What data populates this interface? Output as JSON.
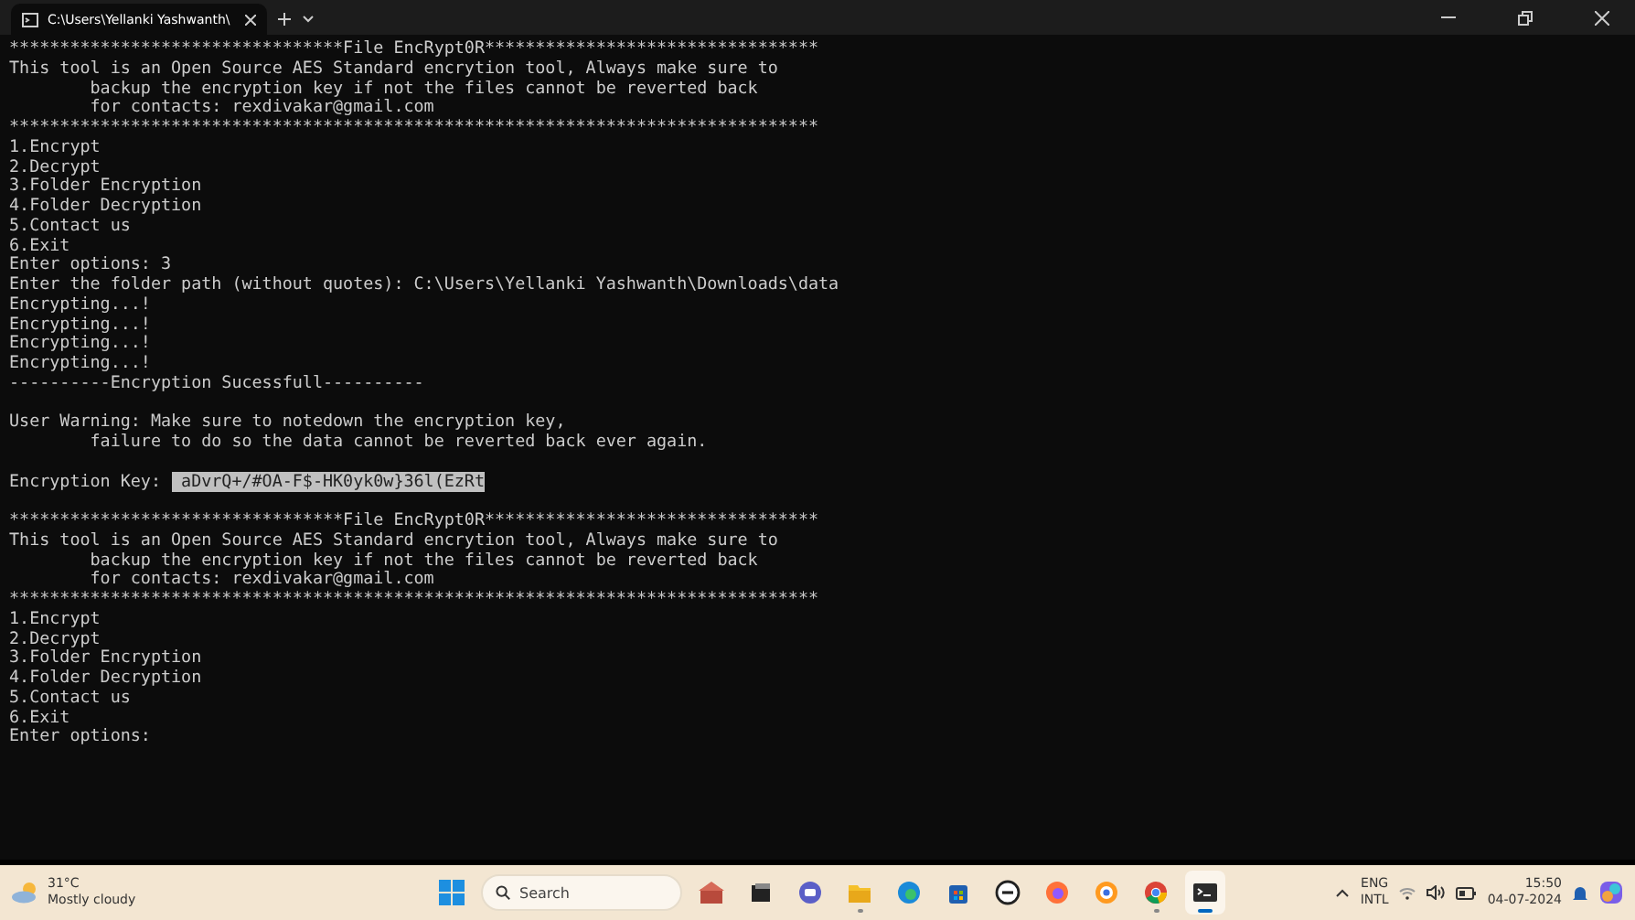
{
  "window": {
    "tab_title": "C:\\Users\\Yellanki Yashwanth\\",
    "tab_selected": true
  },
  "terminal": {
    "lines": [
      {
        "kind": "text",
        "text": "*********************************File EncRypt0R*********************************"
      },
      {
        "kind": "text",
        "text": "This tool is an Open Source AES Standard encrytion tool, Always make sure to"
      },
      {
        "kind": "text",
        "text": "        backup the encryption key if not the files cannot be reverted back"
      },
      {
        "kind": "text",
        "text": "        for contacts: rexdivakar@gmail.com"
      },
      {
        "kind": "text",
        "text": "********************************************************************************"
      },
      {
        "kind": "text",
        "text": "1.Encrypt"
      },
      {
        "kind": "text",
        "text": "2.Decrypt"
      },
      {
        "kind": "text",
        "text": "3.Folder Encryption"
      },
      {
        "kind": "text",
        "text": "4.Folder Decryption"
      },
      {
        "kind": "text",
        "text": "5.Contact us"
      },
      {
        "kind": "text",
        "text": "6.Exit"
      },
      {
        "kind": "text",
        "text": "Enter options: 3"
      },
      {
        "kind": "text",
        "text": "Enter the folder path (without quotes): C:\\Users\\Yellanki Yashwanth\\Downloads\\data"
      },
      {
        "kind": "text",
        "text": "Encrypting...!"
      },
      {
        "kind": "text",
        "text": "Encrypting...!"
      },
      {
        "kind": "text",
        "text": "Encrypting...!"
      },
      {
        "kind": "text",
        "text": "Encrypting...!"
      },
      {
        "kind": "text",
        "text": "----------Encryption Sucessfull----------"
      },
      {
        "kind": "blank"
      },
      {
        "kind": "text",
        "text": "User Warning: Make sure to notedown the encryption key,"
      },
      {
        "kind": "text",
        "text": "        failure to do so the data cannot be reverted back ever again."
      },
      {
        "kind": "blank"
      },
      {
        "kind": "selection",
        "text": "Encryption Key: ",
        "selected_text": " aDvrQ+/#OA-F$-HK0yk0w}36l(EzRt"
      },
      {
        "kind": "blank"
      },
      {
        "kind": "text",
        "text": "*********************************File EncRypt0R*********************************"
      },
      {
        "kind": "text",
        "text": "This tool is an Open Source AES Standard encrytion tool, Always make sure to"
      },
      {
        "kind": "text",
        "text": "        backup the encryption key if not the files cannot be reverted back"
      },
      {
        "kind": "text",
        "text": "        for contacts: rexdivakar@gmail.com"
      },
      {
        "kind": "text",
        "text": "********************************************************************************"
      },
      {
        "kind": "text",
        "text": "1.Encrypt"
      },
      {
        "kind": "text",
        "text": "2.Decrypt"
      },
      {
        "kind": "text",
        "text": "3.Folder Encryption"
      },
      {
        "kind": "text",
        "text": "4.Folder Decryption"
      },
      {
        "kind": "text",
        "text": "5.Contact us"
      },
      {
        "kind": "text",
        "text": "6.Exit"
      },
      {
        "kind": "text",
        "text": "Enter options:"
      }
    ]
  },
  "taskbar": {
    "weather": {
      "temperature": "31°C",
      "condition": "Mostly cloudy"
    },
    "search": {
      "placeholder": "Search"
    },
    "apps": [
      {
        "kind": "start",
        "running": false,
        "selected": false
      },
      {
        "kind": "search"
      },
      {
        "kind": "landmark",
        "running": false,
        "selected": false
      },
      {
        "kind": "taskview",
        "running": false,
        "selected": false
      },
      {
        "kind": "chat",
        "running": false,
        "selected": false
      },
      {
        "kind": "folder",
        "running": true,
        "selected": false
      },
      {
        "kind": "edge",
        "running": false,
        "selected": false
      },
      {
        "kind": "store",
        "running": false,
        "selected": false
      },
      {
        "kind": "dell",
        "running": false,
        "selected": false
      },
      {
        "kind": "firefox",
        "running": false,
        "selected": false
      },
      {
        "kind": "ring",
        "running": false,
        "selected": false
      },
      {
        "kind": "chrome",
        "running": true,
        "selected": false
      },
      {
        "kind": "terminal",
        "running": true,
        "selected": true
      }
    ],
    "tray": {
      "language": "ENG",
      "layout": "INTL",
      "time": "15:50",
      "date": "04-07-2024"
    }
  }
}
